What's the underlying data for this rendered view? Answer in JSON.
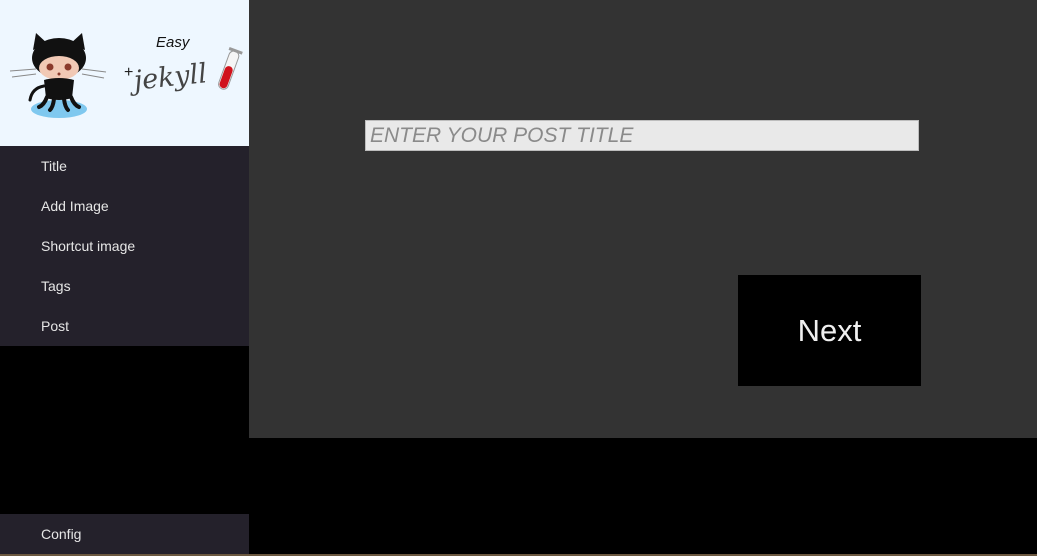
{
  "logo": {
    "easy_label": "Easy",
    "plus_label": "+",
    "jekyll_label": "jekyll",
    "mascot_icon": "octocat-icon",
    "tube_icon": "test-tube-icon"
  },
  "sidebar": {
    "items": [
      {
        "label": "Title"
      },
      {
        "label": "Add Image"
      },
      {
        "label": "Shortcut image"
      },
      {
        "label": "Tags"
      },
      {
        "label": "Post"
      }
    ],
    "config_label": "Config"
  },
  "main": {
    "title_input": {
      "value": "",
      "placeholder": "ENTER YOUR POST TITLE"
    },
    "next_label": "Next"
  },
  "colors": {
    "sidebar_logo_bg": "#eef7ff",
    "sidebar_nav_bg": "#24212b",
    "main_bg": "#333333",
    "background": "#000000",
    "button_bg": "#000000"
  }
}
